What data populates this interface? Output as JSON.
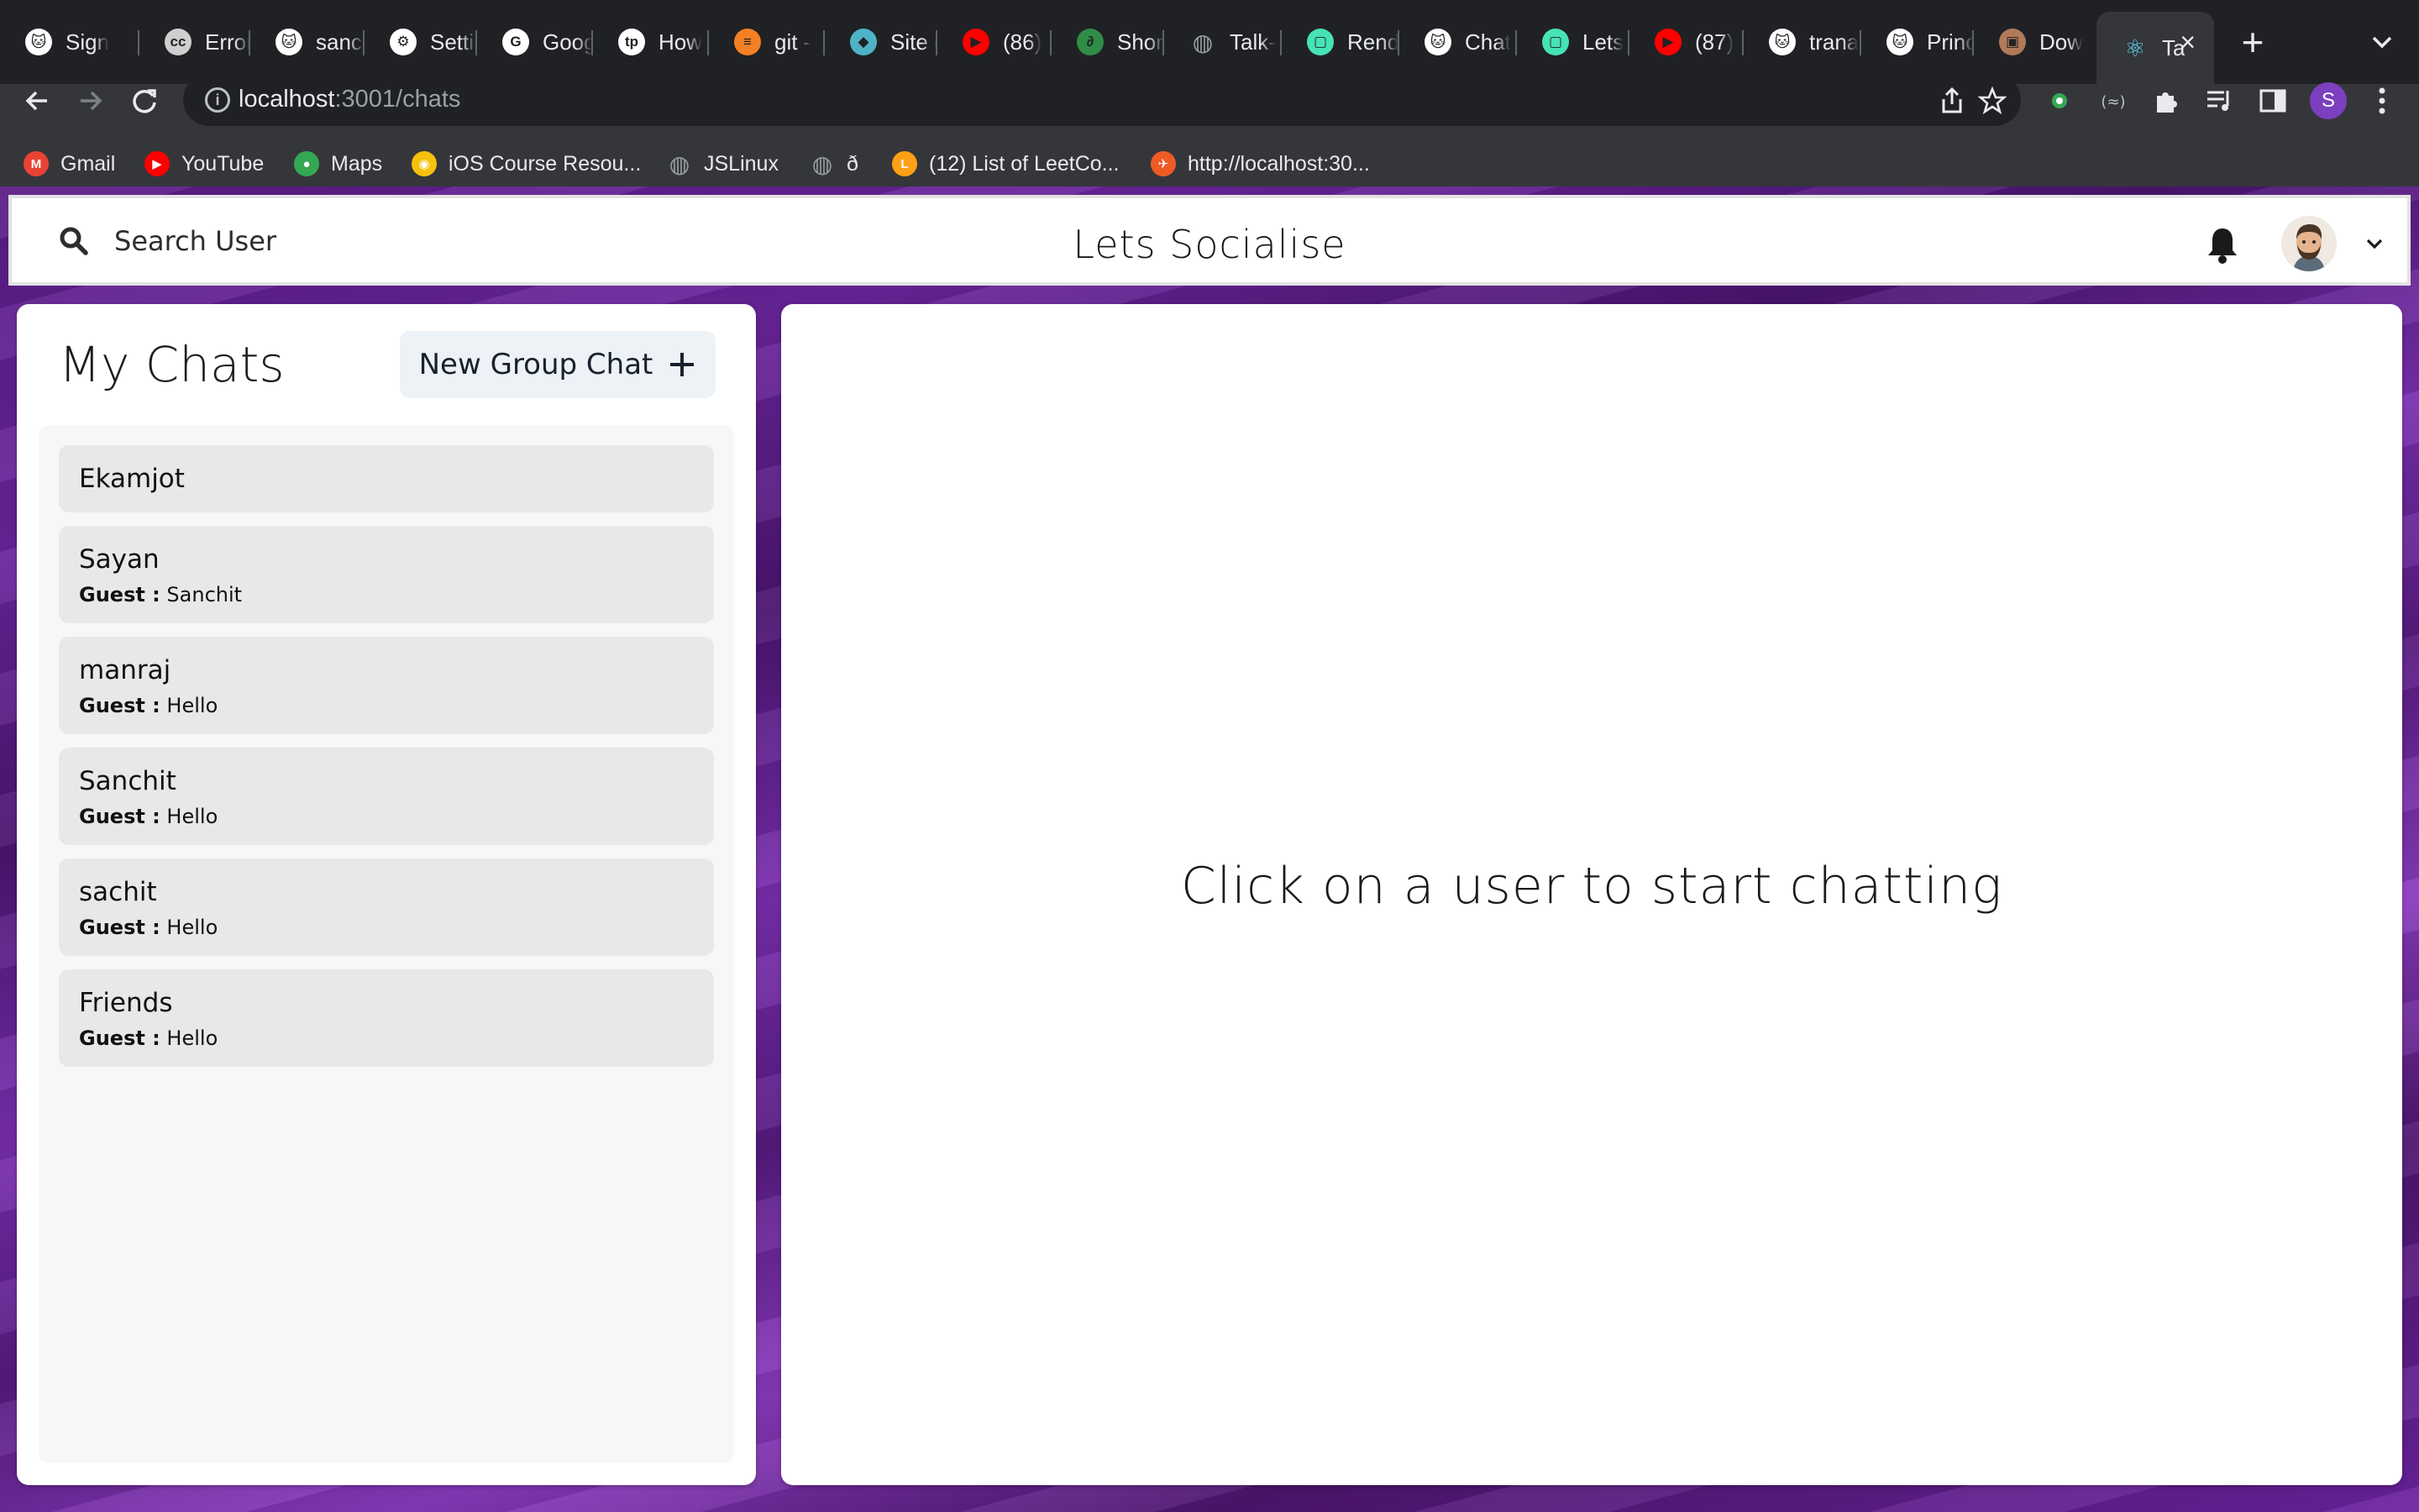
{
  "browser": {
    "tabs": [
      {
        "label": "Sign",
        "icon": "github-icon",
        "color": "#ffffff"
      },
      {
        "label": "Error",
        "icon": "cc-icon",
        "color": "#cfcfcf"
      },
      {
        "label": "sanch",
        "icon": "github-icon",
        "color": "#ffffff"
      },
      {
        "label": "Settin",
        "icon": "gear-icon",
        "color": "#ffffff"
      },
      {
        "label": "Goog",
        "icon": "google-icon",
        "color": "#ffffff"
      },
      {
        "label": "How",
        "icon": "tp-icon",
        "color": "#ffffff"
      },
      {
        "label": "git -",
        "icon": "stackoverflow-icon",
        "color": "#f48024"
      },
      {
        "label": "Site c",
        "icon": "diamond-icon",
        "color": "#4fb3c8"
      },
      {
        "label": "(86)",
        "icon": "youtube-icon",
        "color": "#ff0000"
      },
      {
        "label": "Short",
        "icon": "gfg-icon",
        "color": "#2f8d46"
      },
      {
        "label": "Talk-",
        "icon": "globe-icon",
        "color": "#9aa0a6"
      },
      {
        "label": "Rend",
        "icon": "render-icon",
        "color": "#46e3b7"
      },
      {
        "label": "Chat",
        "icon": "github-icon",
        "color": "#ffffff"
      },
      {
        "label": "Lets",
        "icon": "render-icon",
        "color": "#46e3b7"
      },
      {
        "label": "(87)",
        "icon": "youtube-icon",
        "color": "#ff0000"
      },
      {
        "label": "trana",
        "icon": "github-icon",
        "color": "#ffffff"
      },
      {
        "label": "Princ",
        "icon": "github-icon",
        "color": "#ffffff"
      },
      {
        "label": "Dow",
        "icon": "image-icon",
        "color": "#b07a5a"
      },
      {
        "label": "Ta",
        "icon": "react-icon",
        "color": "#61dafb",
        "active": true
      }
    ],
    "url_host": "localhost",
    "url_path": ":3001/chats",
    "profile_initial": "S",
    "profile_color": "#7b3fbf",
    "bookmarks": [
      {
        "label": "Gmail",
        "icon": "gmail-icon",
        "color": "#ea4335"
      },
      {
        "label": "YouTube",
        "icon": "youtube-icon",
        "color": "#ff0000"
      },
      {
        "label": "Maps",
        "icon": "maps-icon",
        "color": "#34a853"
      },
      {
        "label": "iOS Course Resou...",
        "icon": "ios-course-icon",
        "color": "#f4c20d"
      },
      {
        "label": "JSLinux",
        "icon": "globe-icon",
        "color": "#9aa0a6"
      },
      {
        "label": "ð",
        "icon": "globe-icon",
        "color": "#9aa0a6"
      },
      {
        "label": "(12) List of LeetCo...",
        "icon": "leetcode-icon",
        "color": "#ffa116"
      },
      {
        "label": "http://localhost:30...",
        "icon": "postman-icon",
        "color": "#ef5b25"
      }
    ]
  },
  "app": {
    "search_label": "Search User",
    "title": "Lets Socialise",
    "sidebar_title": "My Chats",
    "new_group_label": "New Group Chat",
    "chats": [
      {
        "name": "Ekamjot",
        "sender": "",
        "message": ""
      },
      {
        "name": "Sayan",
        "sender": "Guest :",
        "message": "Sanchit"
      },
      {
        "name": "manraj",
        "sender": "Guest :",
        "message": "Hello"
      },
      {
        "name": "Sanchit",
        "sender": "Guest :",
        "message": "Hello"
      },
      {
        "name": "sachit",
        "sender": "Guest :",
        "message": "Hello"
      },
      {
        "name": "Friends",
        "sender": "Guest :",
        "message": "Hello"
      }
    ],
    "empty_message": "Click on a user to start chatting"
  }
}
